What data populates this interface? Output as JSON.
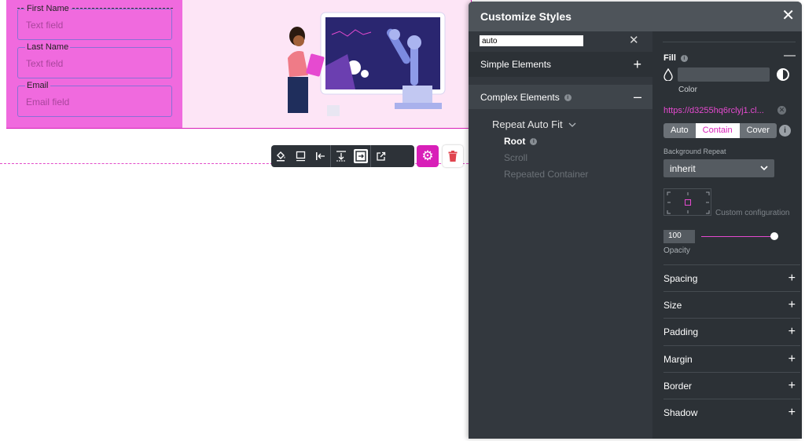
{
  "form": {
    "fields": [
      {
        "label": "First Name",
        "placeholder": "Text field"
      },
      {
        "label": "Last Name",
        "placeholder": "Text field"
      },
      {
        "label": "Email",
        "placeholder": "Email field"
      }
    ]
  },
  "toolbar": {
    "icons": [
      "paint-bucket-icon",
      "border-box-icon",
      "align-left-icon",
      "vertical-align-icon",
      "horizontal-fit-icon",
      "open-external-icon"
    ],
    "gear": "gear-icon",
    "trash": "trash-icon"
  },
  "panel": {
    "title": "Customize Styles",
    "search_value": "auto",
    "sections": {
      "simple": "Simple Elements",
      "complex": "Complex Elements"
    },
    "tree": {
      "component": "Repeat Auto Fit",
      "items": [
        "Root",
        "Scroll",
        "Repeated Container"
      ]
    },
    "fill": {
      "title": "Fill",
      "color_label": "Color",
      "url": "https://d3255hq6rclyj1.cl...",
      "size_options": [
        "Auto",
        "Contain",
        "Cover"
      ],
      "size_selected": "Contain",
      "bg_repeat_label": "Background Repeat",
      "bg_repeat_value": "inherit",
      "custom_config_label": "Custom configuration",
      "opacity_value": "100",
      "opacity_label": "Opacity",
      "opacity_fraction": 1.0
    },
    "accordions": [
      "Spacing",
      "Size",
      "Padding",
      "Margin",
      "Border",
      "Shadow"
    ]
  },
  "colors": {
    "accent": "#d81fb8",
    "panel_bg": "#33383e",
    "form_bg": "#f06ade"
  }
}
